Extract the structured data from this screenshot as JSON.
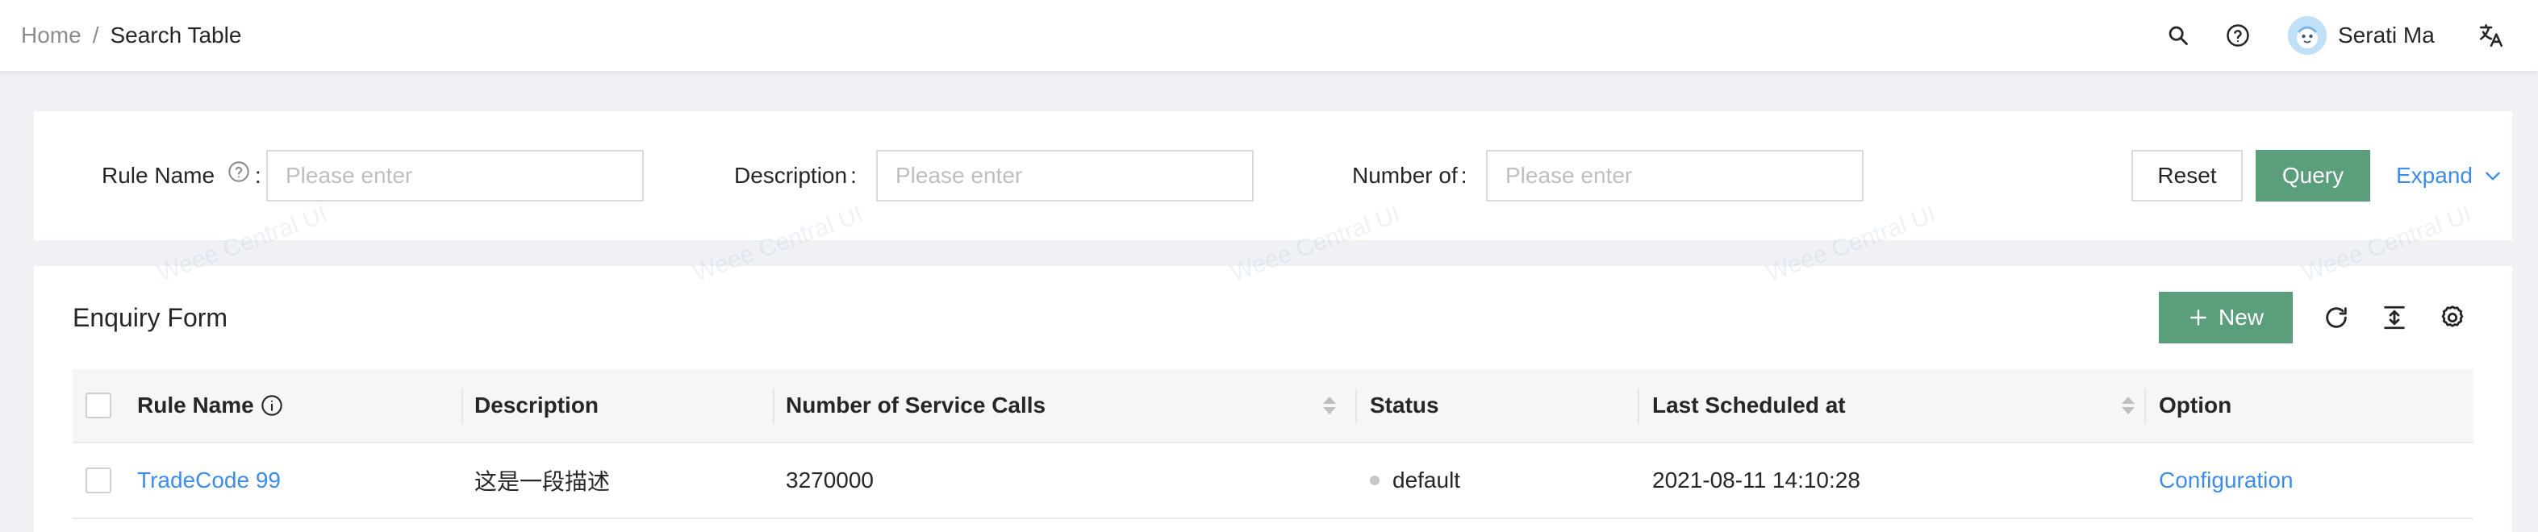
{
  "breadcrumb": {
    "home": "Home",
    "separator": "/",
    "current": "Search Table"
  },
  "header": {
    "user_name": "Serati Ma",
    "icons": [
      "search-icon",
      "help-icon",
      "avatar",
      "language-icon"
    ]
  },
  "filters": {
    "fields": [
      {
        "label": "Rule Name",
        "colon": ":",
        "has_help": true,
        "placeholder": "Please enter"
      },
      {
        "label": "Description",
        "colon": ":",
        "has_help": false,
        "placeholder": "Please enter"
      },
      {
        "label": "Number of",
        "colon": ":",
        "has_help": false,
        "placeholder": "Please enter"
      }
    ],
    "reset_label": "Reset",
    "query_label": "Query",
    "expand_label": "Expand"
  },
  "table_panel": {
    "title": "Enquiry Form",
    "new_label": "New",
    "tool_icons": [
      "reload-icon",
      "density-icon",
      "settings-icon"
    ]
  },
  "table": {
    "columns": [
      "Rule Name",
      "Description",
      "Number of Service Calls",
      "Status",
      "Last Scheduled at",
      "Option"
    ],
    "rows": [
      {
        "rule_name": "TradeCode 99",
        "description": "这是一段描述",
        "service_calls": "3270000",
        "status": "default",
        "last_scheduled": "2021-08-11 14:10:28",
        "option": "Configuration"
      }
    ]
  },
  "watermark_text": "Weee Central UI",
  "colors": {
    "primary_green": "#5a9e7c",
    "link_blue": "#3d8de8",
    "page_bg": "#f0f1f5"
  }
}
